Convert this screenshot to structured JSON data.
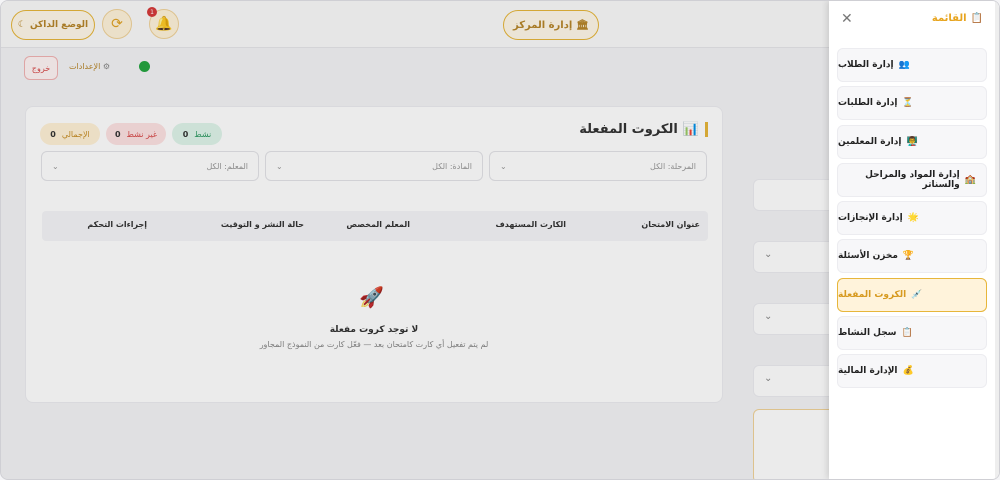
{
  "header": {
    "center_button": "إدارة المركز",
    "dark_mode": "الوضع الداكن",
    "notif_count": "1"
  },
  "subbar": {
    "logout": "خروج",
    "settings": "الإعدادات"
  },
  "card": {
    "title": "الكروت المفعلة",
    "stats": {
      "active_label": "نشط",
      "active_value": "0",
      "inactive_label": "غير نشط",
      "inactive_value": "0",
      "total_label": "الإجمالي",
      "total_value": "0"
    },
    "filters": {
      "stage": "المرحلة: الكل",
      "subject": "المادة: الكل",
      "teacher": "المعلم: الكل"
    },
    "columns": [
      "عنوان الامتحان",
      "الكارت المستهدف",
      "المعلم المخصص",
      "حالة النشر و التوقيت",
      "إجراءات التحكم"
    ],
    "empty_title": "لا توجد كروت مفعلة",
    "empty_sub": "لم يتم تفعيل أي كارت كامتحان بعد — فعّل كارت من النموذج المجاور"
  },
  "drawer": {
    "title": "القائمة",
    "items": [
      {
        "label": "إدارة الطلاب",
        "icon": "👥"
      },
      {
        "label": "إدارة الطلبات",
        "icon": "⏳"
      },
      {
        "label": "إدارة المعلمين",
        "icon": "👨‍🏫"
      },
      {
        "label": "إدارة المواد والمراحل والسناتر",
        "icon": "🏫"
      },
      {
        "label": "إدارة الإنجازات",
        "icon": "🌟"
      },
      {
        "label": "مخزن الأسئلة",
        "icon": "🏆"
      },
      {
        "label": "الكروت المفعلة",
        "icon": "💉"
      },
      {
        "label": "سجل النشاط",
        "icon": "📋"
      },
      {
        "label": "الإدارة المالية",
        "icon": "💰"
      }
    ],
    "active_index": 6
  },
  "colors": {
    "accent": "#e7b63a",
    "danger": "#d84a4a"
  }
}
